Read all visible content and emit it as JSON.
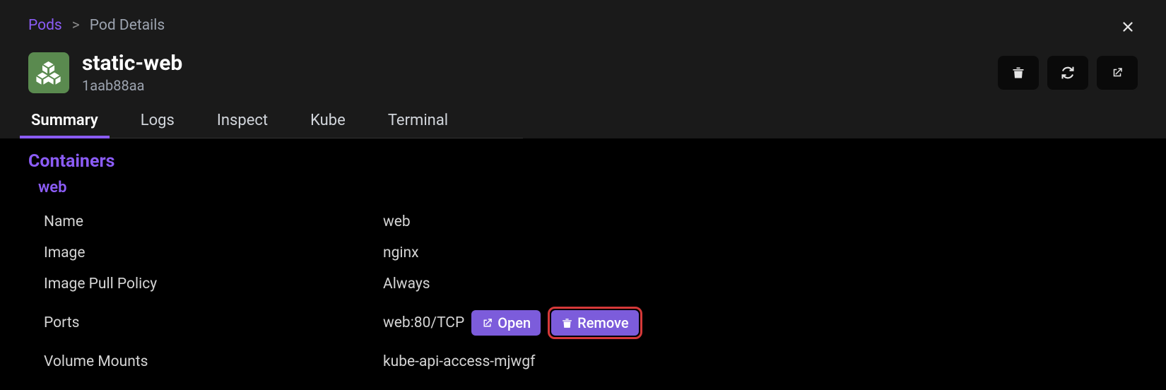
{
  "breadcrumb": {
    "root": "Pods",
    "current": "Pod Details"
  },
  "pod": {
    "title": "static-web",
    "id": "1aab88aa"
  },
  "tabs": [
    {
      "label": "Summary",
      "active": true
    },
    {
      "label": "Logs",
      "active": false
    },
    {
      "label": "Inspect",
      "active": false
    },
    {
      "label": "Kube",
      "active": false
    },
    {
      "label": "Terminal",
      "active": false
    }
  ],
  "section": {
    "title": "Containers",
    "container_name": "web"
  },
  "details": {
    "name_label": "Name",
    "name_value": "web",
    "image_label": "Image",
    "image_value": "nginx",
    "pull_policy_label": "Image Pull Policy",
    "pull_policy_value": "Always",
    "ports_label": "Ports",
    "ports_value": "web:80/TCP",
    "volume_mounts_label": "Volume Mounts",
    "volume_mounts_value": "kube-api-access-mjwgf"
  },
  "buttons": {
    "open": "Open",
    "remove": "Remove"
  },
  "colors": {
    "accent": "#8b5cf6",
    "btn_bg": "#7c5cdb",
    "pod_icon_bg": "#5a8a4f",
    "highlight_border": "#d63939"
  }
}
